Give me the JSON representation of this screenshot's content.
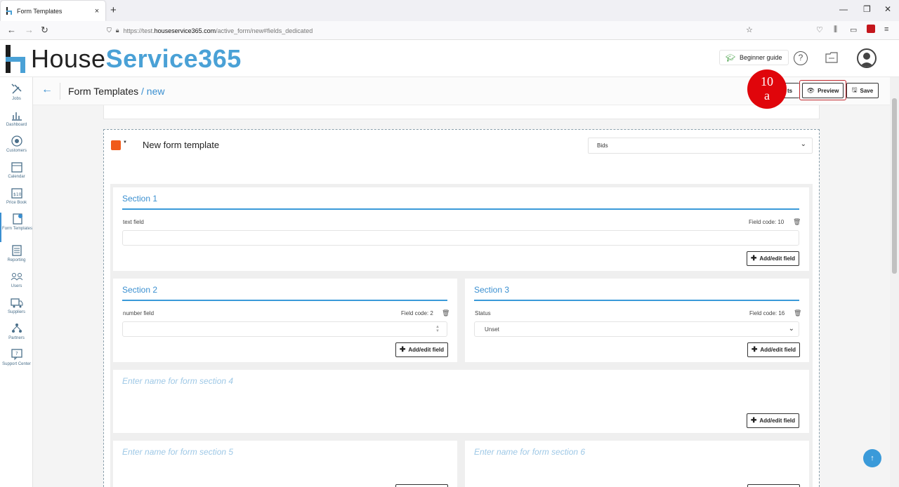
{
  "browser": {
    "tab_title": "Form Templates",
    "tab_close": "×",
    "new_tab": "+",
    "url_prefix": "https://test.",
    "url_domain": "houseservice365.com",
    "url_path": "/active_form/new#fields_dedicated",
    "win_minimize": "—",
    "win_restore": "❐",
    "win_close": "✕"
  },
  "header": {
    "logo_dark": "House",
    "logo_blue": "Service365",
    "beginner_guide": "Beginner guide",
    "help": "?"
  },
  "sidebar": {
    "items": [
      {
        "label": "Jobs"
      },
      {
        "label": "Dashboard"
      },
      {
        "label": "Customers"
      },
      {
        "label": "Calendar"
      },
      {
        "label": "Price Book"
      },
      {
        "label": "Form Templates"
      },
      {
        "label": "Reporting"
      },
      {
        "label": "Users"
      },
      {
        "label": "Suppliers"
      },
      {
        "label": "Partners"
      },
      {
        "label": "Support Center"
      }
    ]
  },
  "subheader": {
    "crumb_main": "Form Templates",
    "crumb_sep": " / ",
    "crumb_current": "new",
    "partial_button": "ts",
    "preview_label": "Preview",
    "save_label": "Save"
  },
  "annotation": {
    "line1": "10",
    "line2": "a"
  },
  "template": {
    "name": "New form template",
    "type": "Bids"
  },
  "sections": [
    {
      "title": "Section 1",
      "field_label": "text field",
      "field_code": "Field code: 10",
      "add_label": "Add/edit field"
    },
    {
      "title": "Section 2",
      "field_label": "number field",
      "field_code": "Field code: 2",
      "add_label": "Add/edit field"
    },
    {
      "title": "Section 3",
      "field_label": "Status",
      "field_code": "Field code: 16",
      "field_value": "Unset",
      "add_label": "Add/edit field"
    },
    {
      "placeholder": "Enter name for form section 4",
      "add_label": "Add/edit field"
    },
    {
      "placeholder": "Enter name for form section 5"
    },
    {
      "placeholder": "Enter name for form section 6"
    }
  ],
  "scroll_top": "↑",
  "colors": {
    "accent": "#3a8fd0",
    "swatch": "#f05a1a",
    "annotation": "#e0050b"
  }
}
